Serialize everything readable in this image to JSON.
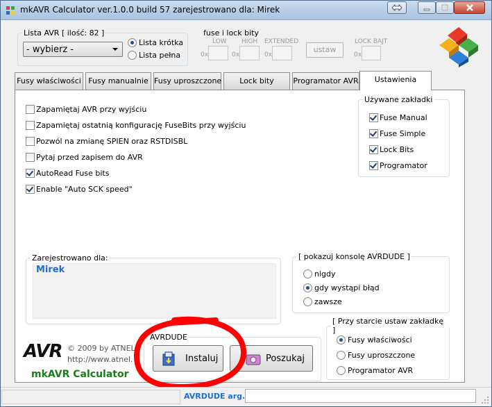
{
  "window": {
    "title": "mkAVR Calculator ver.1.0.0 build 57  zarejestrowano dla: Mirek"
  },
  "lista": {
    "legend": "Lista AVR [ ilość: 82 ]",
    "select_value": "- wybierz -",
    "radio_short": "Lista krótka",
    "radio_full": "Lista pełna"
  },
  "fuse": {
    "legend": "fuse i lock bity",
    "low": "LOW",
    "high": "HIGH",
    "extended": "EXTENDED",
    "lock": "LOCK BAJT",
    "prefix": "0x",
    "ustaw": "ustaw"
  },
  "tabs": [
    "Fusy właściwości",
    "Fusy manualnie",
    "Fusy uproszczone",
    "Lock bity",
    "Programator AVR",
    "Ustawienia"
  ],
  "options": [
    {
      "label": "Zapamiętaj AVR przy wyjściu",
      "checked": false
    },
    {
      "label": "Zapamiętaj ostatnią konfigurację FuseBits przy wyjściu",
      "checked": false
    },
    {
      "label": "Pozwól na zmianę SPIEN oraz RSTDISBL",
      "checked": false
    },
    {
      "label": "Pytaj przed zapisem do AVR",
      "checked": false
    },
    {
      "label": "AutoRead Fuse bits",
      "checked": true
    },
    {
      "label": "Enable \"Auto SCK speed\"",
      "checked": true
    }
  ],
  "used_tabs": {
    "legend": "Używane zakładki",
    "items": [
      "Fuse Manual",
      "Fuse Simple",
      "Lock Bits",
      "Programator"
    ]
  },
  "registered": {
    "legend": "Zarejestrowano dla:",
    "name": "Mirek"
  },
  "console": {
    "legend": "[ pokazuj konsolę AVRDUDE ]",
    "items": [
      "nigdy",
      "gdy wystąpi błąd",
      "zawsze"
    ],
    "selected": 1
  },
  "startup": {
    "legend": "[ Przy starcie ustaw zakładkę ]",
    "items": [
      "Fusy właściwości",
      "Fusy uproszczone",
      "Programator AVR"
    ],
    "selected": 0
  },
  "brand": {
    "logo": "AVR",
    "copyright": "©  2009 by ATNEL",
    "url": "http://www.atnel.",
    "app": "mkAVR Calculator"
  },
  "avrdude": {
    "legend": "AVRDUDE",
    "install": "Instaluj",
    "search": "Poszukaj"
  },
  "status": {
    "label": "AVRDUDE arg."
  },
  "colors": {
    "accent": "#1f6fd1",
    "annotation": "#ff0000",
    "brand_green": "#1a7d1a"
  }
}
